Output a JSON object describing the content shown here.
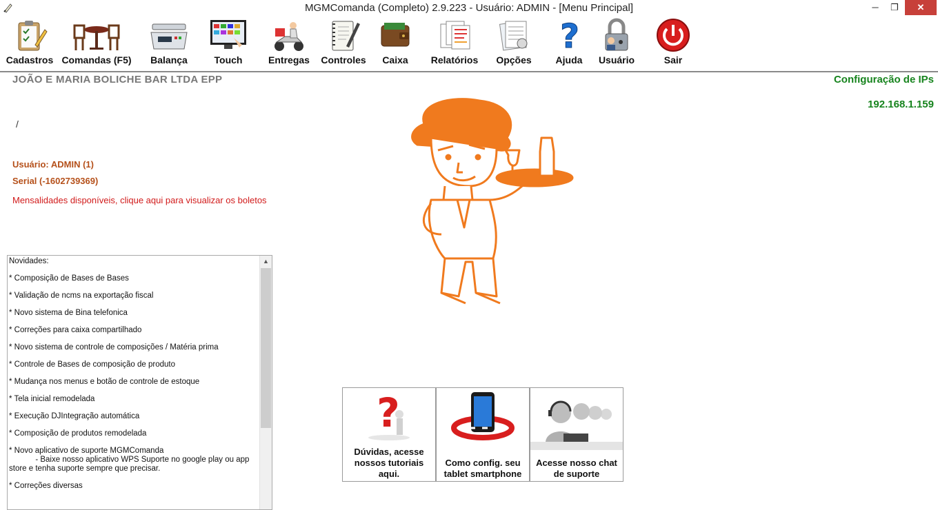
{
  "window": {
    "title": "MGMComanda (Completo) 2.9.223 - Usuário: ADMIN - [Menu Principal]",
    "min_glyph": "─",
    "max_glyph": "❐",
    "close_glyph": "✕"
  },
  "toolbar": {
    "items": [
      {
        "label": "Cadastros",
        "icon": "clipboard-check-icon"
      },
      {
        "label": "Comandas (F5)",
        "icon": "restaurant-table-icon"
      },
      {
        "label": "Balança",
        "icon": "scale-icon"
      },
      {
        "label": "Touch",
        "icon": "touch-monitor-icon"
      },
      {
        "label": "Entregas",
        "icon": "delivery-scooter-icon"
      },
      {
        "label": "Controles",
        "icon": "notebook-pen-icon"
      },
      {
        "label": "Caixa",
        "icon": "wallet-icon"
      },
      {
        "label": "Relatórios",
        "icon": "reports-icon"
      },
      {
        "label": "Opções",
        "icon": "options-doc-icon"
      },
      {
        "label": "Ajuda",
        "icon": "help-question-icon"
      },
      {
        "label": "Usuário",
        "icon": "user-lock-icon"
      },
      {
        "label": "Sair",
        "icon": "power-icon"
      }
    ]
  },
  "company": {
    "name": "JOÃO E MARIA BOLICHE BAR LTDA EPP",
    "slash": "/"
  },
  "user": {
    "line1": "Usuário: ADMIN (1)",
    "line2": "Serial (-1602739369)"
  },
  "notice": "Mensalidades disponíveis, clique aqui para visualizar os boletos",
  "ip": {
    "title": "Configuração de IPs",
    "value": "192.168.1.159"
  },
  "news": {
    "header": "Novidades:",
    "items": [
      "* Composição de Bases de Bases",
      "* Validação de ncms na exportação fiscal",
      "* Novo sistema de Bina telefonica",
      "* Correções para caixa compartilhado",
      "* Novo sistema de controle de composições / Matéria prima",
      "* Controle de Bases de composição de produto",
      "* Mudança nos menus e botão de controle de estoque",
      "* Tela inicial remodelada",
      "* Execução DJIntegração automática",
      "* Composição de produtos remodelada",
      "* Novo aplicativo de suporte MGMComanda\n            - Baixe nosso aplicativo WPS Suporte no google play ou app store e tenha suporte sempre que precisar.",
      "* Correções diversas"
    ]
  },
  "tiles": [
    {
      "label": "Dúvidas, acesse nossos tutoriais aqui.",
      "icon": "question-figure-icon"
    },
    {
      "label": "Como config. seu tablet smartphone",
      "icon": "smartphone-lifebuoy-icon"
    },
    {
      "label": "Acesse nosso chat de suporte",
      "icon": "support-headset-icon"
    }
  ],
  "colors": {
    "orange": "#f07a1e",
    "company_gray": "#777777",
    "user_brown": "#b5501a",
    "notice_red": "#d11a1a",
    "ip_green": "#17841e"
  }
}
